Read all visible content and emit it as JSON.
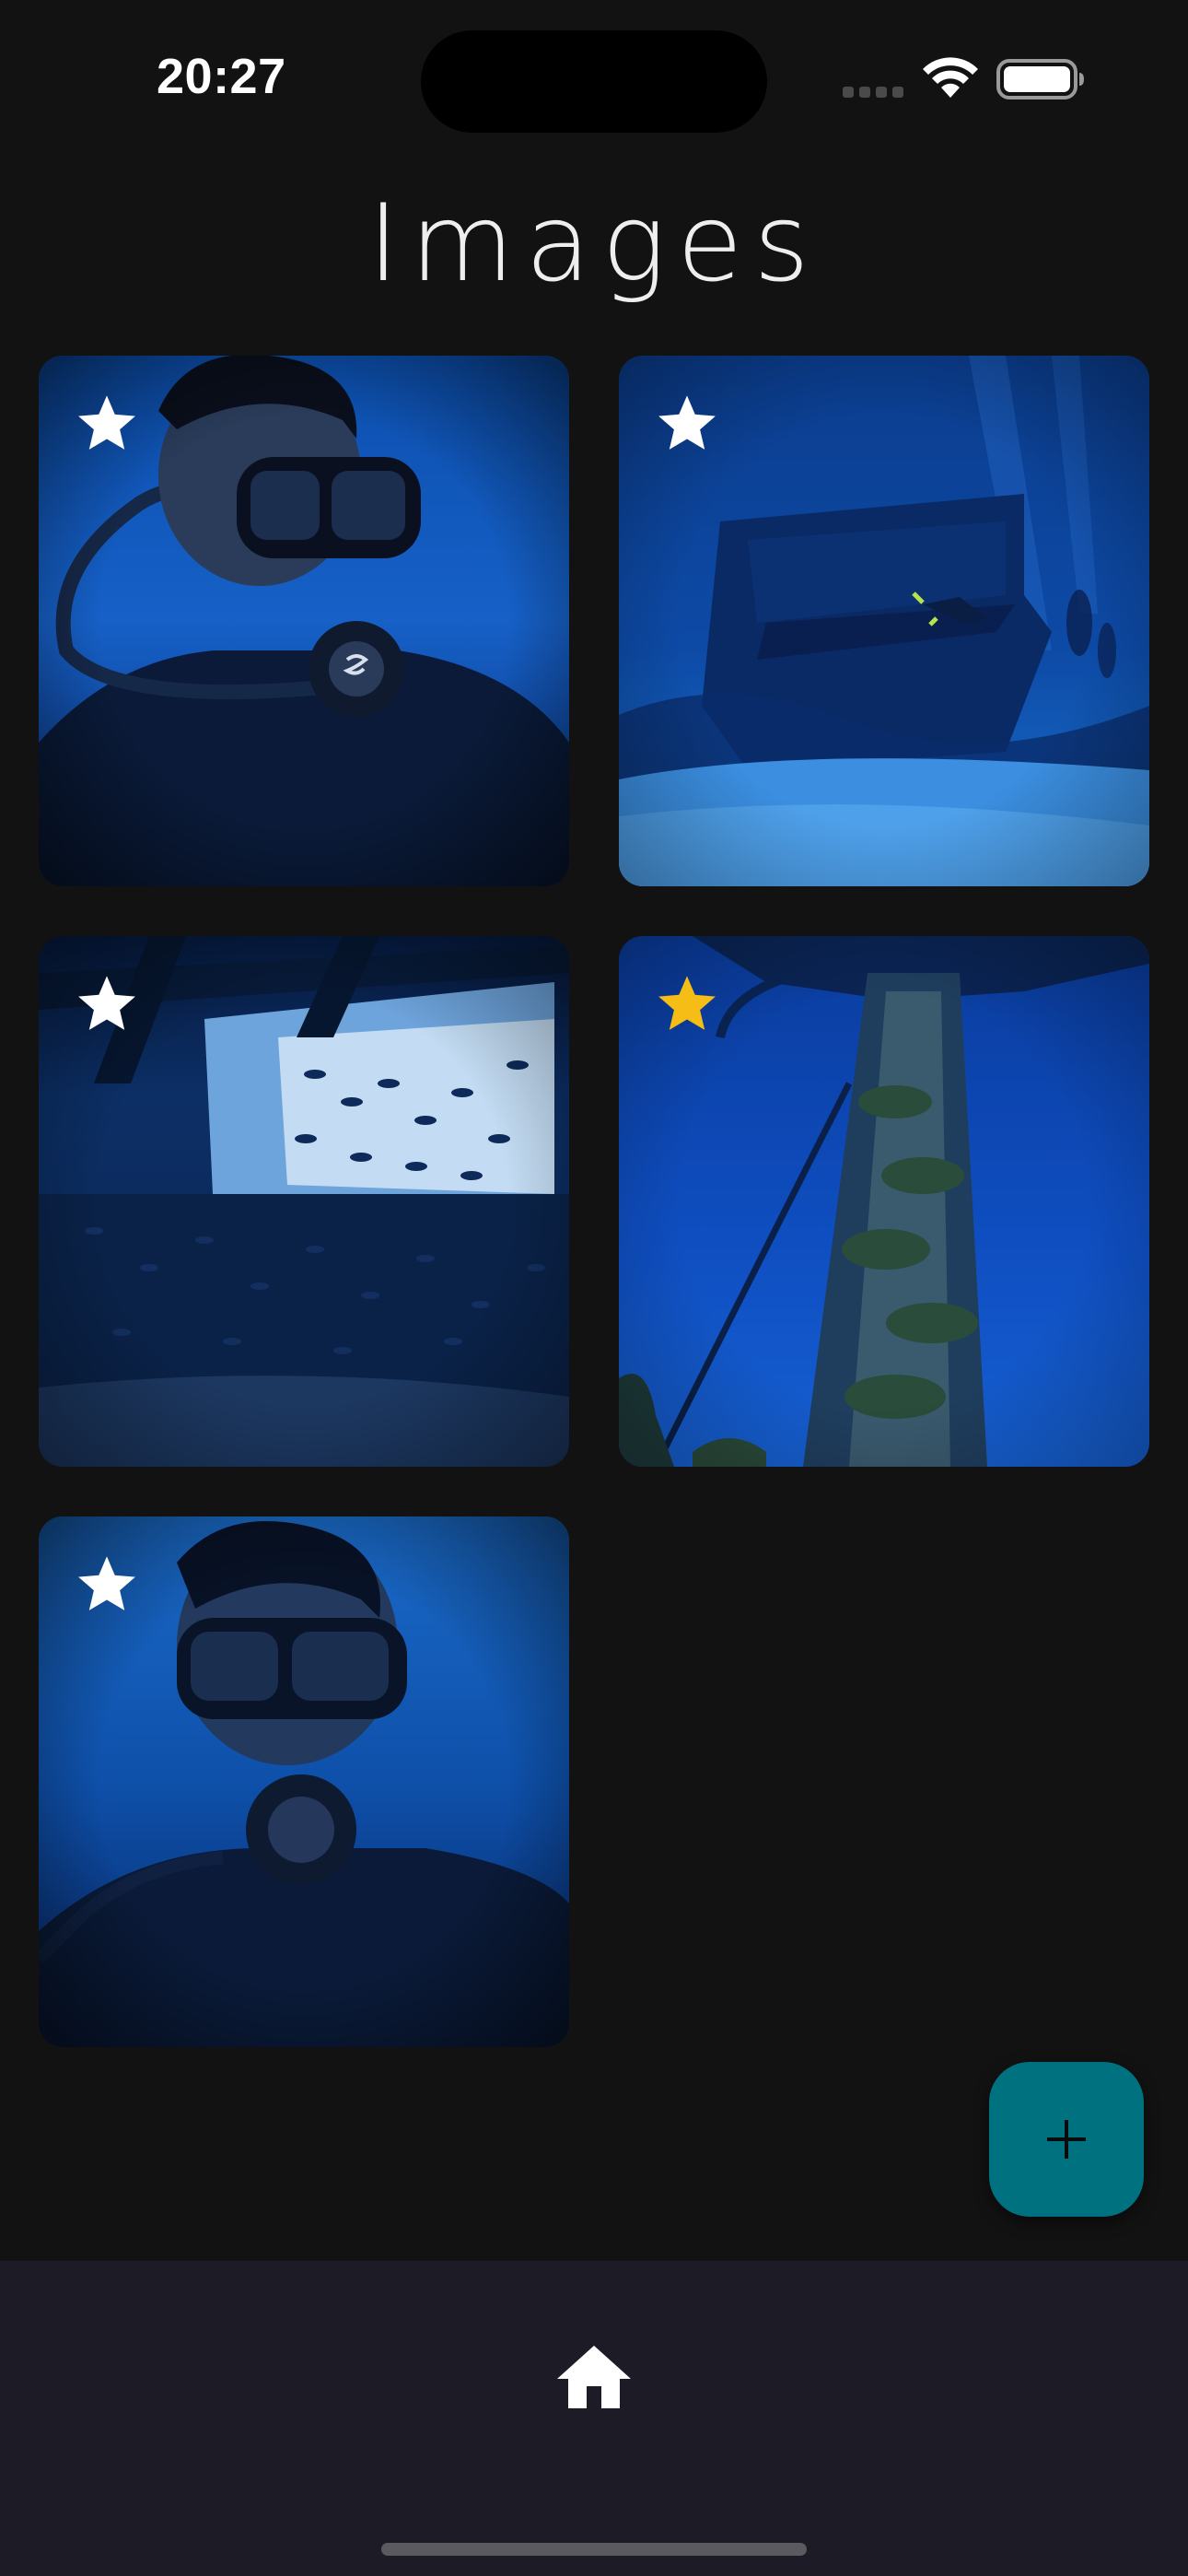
{
  "status_bar": {
    "time": "20:27",
    "icons": [
      "cell-signal-icon",
      "wifi-icon",
      "battery-icon"
    ]
  },
  "header": {
    "title": "Images"
  },
  "gallery": {
    "items": [
      {
        "subject": "diver-selfie-with-regulator",
        "favorite": false
      },
      {
        "subject": "shipwreck-with-divers",
        "favorite": false
      },
      {
        "subject": "fish-school-inside-wreck",
        "favorite": false
      },
      {
        "subject": "wreck-mast-underwater",
        "favorite": true
      },
      {
        "subject": "diver-selfie-from-below",
        "favorite": false
      }
    ]
  },
  "fab": {
    "icon": "plus-icon"
  },
  "bottom_nav": {
    "items": [
      {
        "icon": "home-icon",
        "active": true
      }
    ]
  },
  "colors": {
    "background": "#121212",
    "nav_background": "#1d1b25",
    "fab": "#00727f",
    "star_default": "#ffffff",
    "star_favorite": "#f5bd16"
  }
}
